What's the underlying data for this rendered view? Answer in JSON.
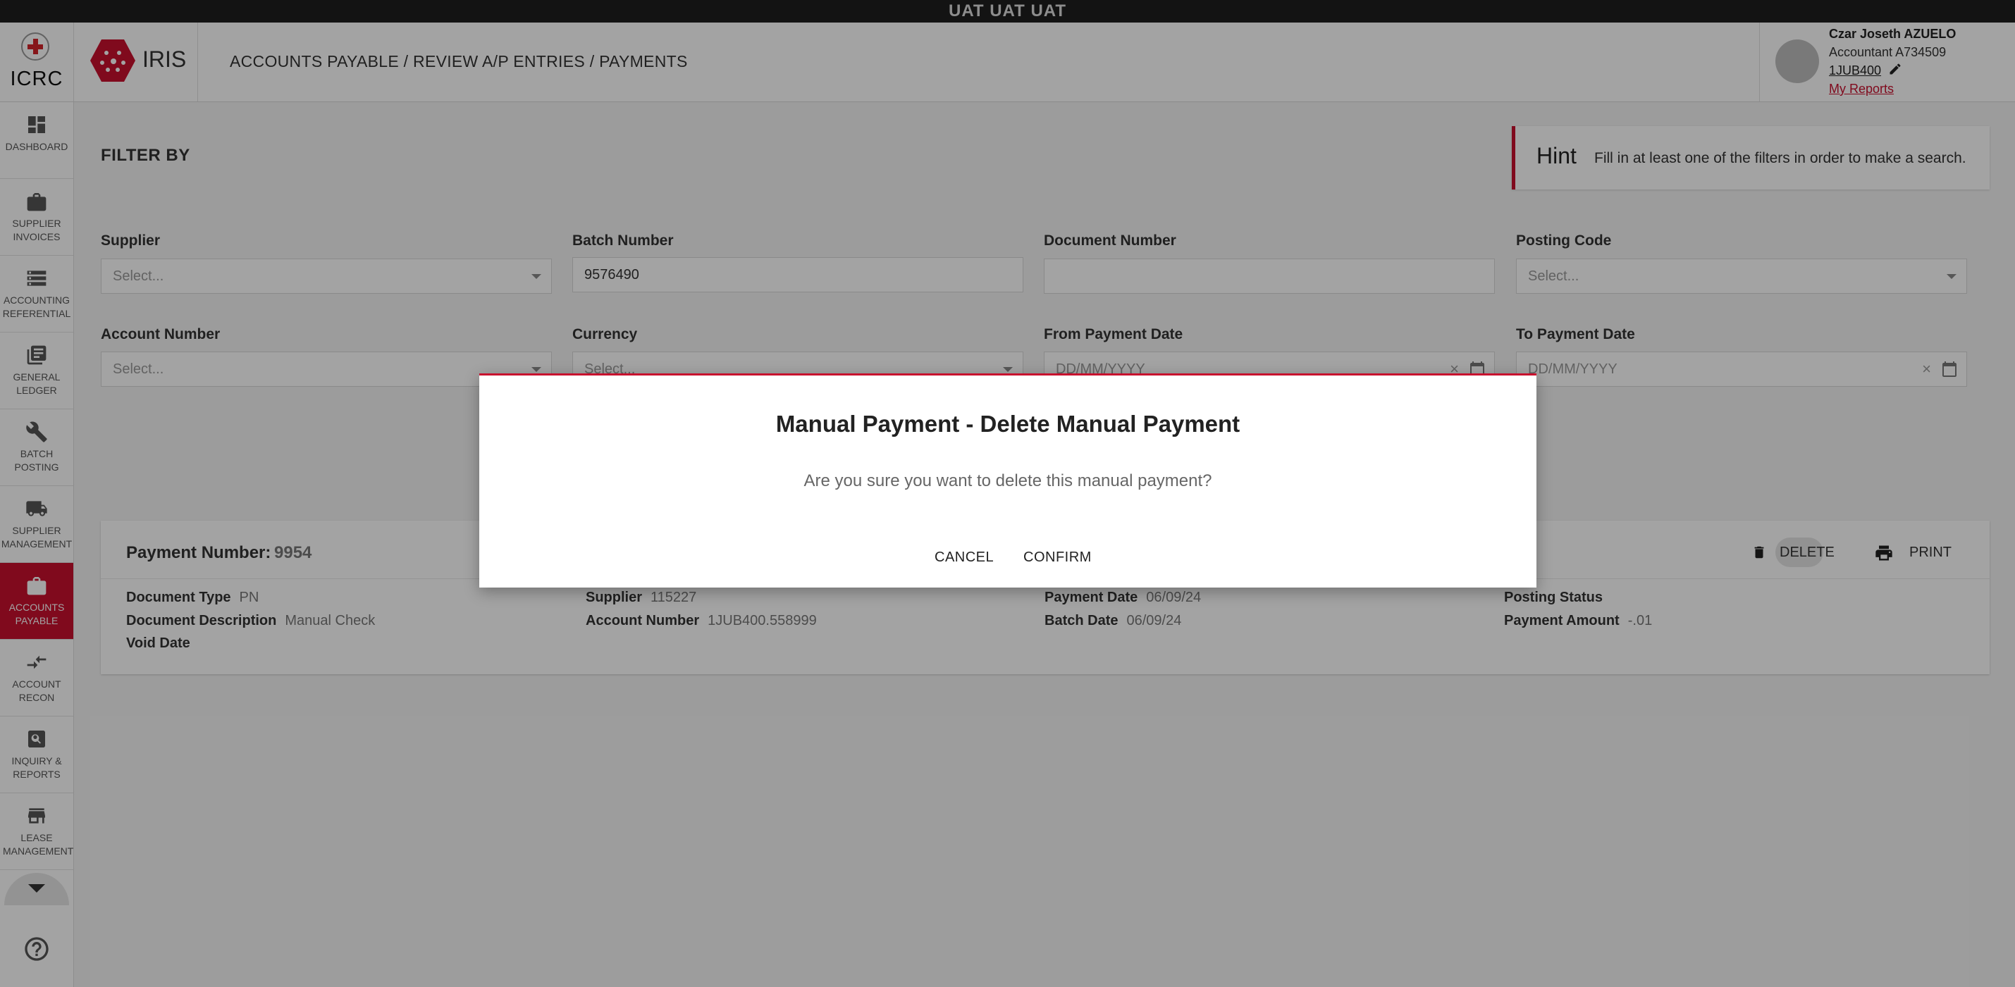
{
  "env_banner": "UAT UAT UAT",
  "brand": {
    "org": "ICRC",
    "app": "IRIS"
  },
  "breadcrumb": "ACCOUNTS PAYABLE / REVIEW A/P ENTRIES / PAYMENTS",
  "user": {
    "name": "Czar Joseth AZUELO",
    "role": "Accountant A734509",
    "code": "1JUB400",
    "reports_link": "My Reports"
  },
  "sidebar": {
    "items": [
      {
        "label": "DASHBOARD",
        "icon": "dashboard-icon"
      },
      {
        "label": "SUPPLIER INVOICES",
        "icon": "briefcase-icon"
      },
      {
        "label": "ACCOUNTING REFERENTIAL",
        "icon": "storage-icon"
      },
      {
        "label": "GENERAL LEDGER",
        "icon": "ledger-icon"
      },
      {
        "label": "BATCH POSTING",
        "icon": "wrench-icon"
      },
      {
        "label": "SUPPLIER MANAGEMENT",
        "icon": "truck-icon"
      },
      {
        "label": "ACCOUNTS PAYABLE",
        "icon": "briefcase-icon",
        "active": true
      },
      {
        "label": "ACCOUNT RECON",
        "icon": "compare-arrows-icon"
      },
      {
        "label": "INQUIRY & REPORTS",
        "icon": "search-icon"
      },
      {
        "label": "LEASE MANAGEMENT",
        "icon": "store-icon"
      }
    ]
  },
  "filters": {
    "title": "FILTER BY",
    "hint_title": "Hint",
    "hint_text": "Fill in at least one of the filters in order to make a search.",
    "supplier": {
      "label": "Supplier",
      "placeholder": "Select..."
    },
    "batch_number": {
      "label": "Batch Number",
      "value": "9576490"
    },
    "document_number": {
      "label": "Document Number",
      "value": ""
    },
    "posting_code": {
      "label": "Posting Code",
      "placeholder": "Select..."
    },
    "account_number": {
      "label": "Account Number",
      "placeholder": "Select..."
    },
    "currency": {
      "label": "Currency",
      "placeholder": "Select..."
    },
    "from_payment_date": {
      "label": "From Payment Date",
      "placeholder": "DD/MM/YYYY"
    },
    "to_payment_date": {
      "label": "To Payment Date",
      "placeholder": "DD/MM/YYYY"
    }
  },
  "payment": {
    "number_label": "Payment Number:",
    "number": "9954",
    "delete_label": "DELETE",
    "print_label": "PRINT",
    "fields": {
      "document_type": {
        "k": "Document Type",
        "v": "PN"
      },
      "document_description": {
        "k": "Document Description",
        "v": "Manual Check"
      },
      "void_date": {
        "k": "Void Date",
        "v": ""
      },
      "supplier": {
        "k": "Supplier",
        "v": "115227"
      },
      "account_number": {
        "k": "Account Number",
        "v": "1JUB400.558999"
      },
      "payment_date": {
        "k": "Payment Date",
        "v": "06/09/24"
      },
      "batch_date": {
        "k": "Batch Date",
        "v": "06/09/24"
      },
      "posting_status": {
        "k": "Posting Status",
        "v": ""
      },
      "payment_amount": {
        "k": "Payment Amount",
        "v": "-.01"
      }
    }
  },
  "modal": {
    "title": "Manual Payment - Delete Manual Payment",
    "message": "Are you sure you want to delete this manual payment?",
    "cancel": "CANCEL",
    "confirm": "CONFIRM"
  },
  "colors": {
    "accent": "#c8102e",
    "env_bar": "#1e1e1e"
  }
}
